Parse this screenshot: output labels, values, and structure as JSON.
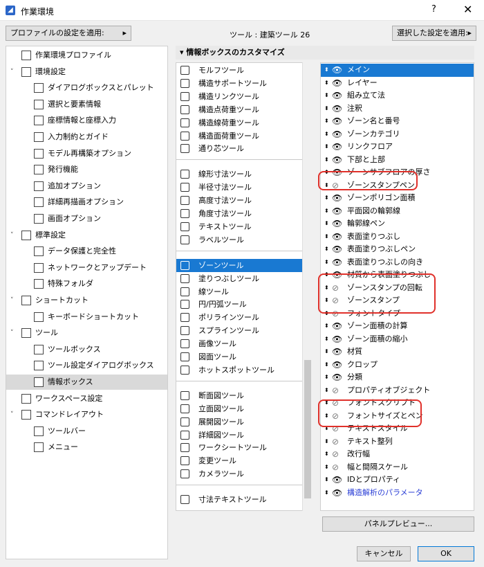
{
  "window": {
    "title": "作業環境",
    "help_label": "?",
    "close_label": "✕",
    "apply_profile_label": "プロファイルの設定を適用:",
    "tool_header": "ツール : 建築ツール 26",
    "apply_selected_label": "選択した設定を適用:"
  },
  "tree": [
    {
      "label": "作業環境プロファイル",
      "level": 0,
      "chev": ""
    },
    {
      "label": "環境設定",
      "level": 0,
      "chev": "˅"
    },
    {
      "label": "ダイアログボックスとパレット",
      "level": 1,
      "chev": ""
    },
    {
      "label": "選択と要素情報",
      "level": 1,
      "chev": ""
    },
    {
      "label": "座標情報と座標入力",
      "level": 1,
      "chev": ""
    },
    {
      "label": "入力制約とガイド",
      "level": 1,
      "chev": ""
    },
    {
      "label": "モデル再構築オプション",
      "level": 1,
      "chev": ""
    },
    {
      "label": "発行機能",
      "level": 1,
      "chev": ""
    },
    {
      "label": "追加オプション",
      "level": 1,
      "chev": ""
    },
    {
      "label": "詳細再描画オプション",
      "level": 1,
      "chev": ""
    },
    {
      "label": "画面オプション",
      "level": 1,
      "chev": ""
    },
    {
      "label": "標準設定",
      "level": 0,
      "chev": "˅"
    },
    {
      "label": "データ保護と完全性",
      "level": 1,
      "chev": ""
    },
    {
      "label": "ネットワークとアップデート",
      "level": 1,
      "chev": ""
    },
    {
      "label": "特殊フォルダ",
      "level": 1,
      "chev": ""
    },
    {
      "label": "ショートカット",
      "level": 0,
      "chev": "˅"
    },
    {
      "label": "キーボードショートカット",
      "level": 1,
      "chev": ""
    },
    {
      "label": "ツール",
      "level": 0,
      "chev": "˅"
    },
    {
      "label": "ツールボックス",
      "level": 1,
      "chev": ""
    },
    {
      "label": "ツール設定ダイアログボックス",
      "level": 1,
      "chev": ""
    },
    {
      "label": "情報ボックス",
      "level": 1,
      "chev": "",
      "selected": true
    },
    {
      "label": "ワークスペース設定",
      "level": 0,
      "chev": ""
    },
    {
      "label": "コマンドレイアウト",
      "level": 0,
      "chev": "˅"
    },
    {
      "label": "ツールバー",
      "level": 1,
      "chev": ""
    },
    {
      "label": "メニュー",
      "level": 1,
      "chev": ""
    }
  ],
  "section_title": "情報ボックスのカスタマイズ",
  "tool_list": [
    {
      "label": "モルフツール"
    },
    {
      "label": "構造サポートツール"
    },
    {
      "label": "構造リンクツール"
    },
    {
      "label": "構造点荷重ツール"
    },
    {
      "label": "構造線荷重ツール"
    },
    {
      "label": "構造面荷重ツール"
    },
    {
      "label": "通り芯ツール"
    },
    {
      "sep": true
    },
    {
      "label": "線形寸法ツール"
    },
    {
      "label": "半径寸法ツール"
    },
    {
      "label": "高度寸法ツール"
    },
    {
      "label": "角度寸法ツール"
    },
    {
      "label": "テキストツール"
    },
    {
      "label": "ラベルツール"
    },
    {
      "sep": true
    },
    {
      "label": "ゾーンツール",
      "selected": true
    },
    {
      "label": "塗りつぶしツール"
    },
    {
      "label": "線ツール"
    },
    {
      "label": "円/円弧ツール"
    },
    {
      "label": "ポリラインツール"
    },
    {
      "label": "スプラインツール"
    },
    {
      "label": "画像ツール"
    },
    {
      "label": "図面ツール"
    },
    {
      "label": "ホットスポットツール"
    },
    {
      "sep": true
    },
    {
      "label": "断面図ツール"
    },
    {
      "label": "立面図ツール"
    },
    {
      "label": "展開図ツール"
    },
    {
      "label": "詳細図ツール"
    },
    {
      "label": "ワークシートツール"
    },
    {
      "label": "変更ツール"
    },
    {
      "label": "カメラツール"
    },
    {
      "sep": true
    },
    {
      "label": "寸法テキストツール"
    }
  ],
  "panel_list": [
    {
      "label": "メイン",
      "visible": true,
      "selected": true
    },
    {
      "label": "レイヤー",
      "visible": true
    },
    {
      "label": "組み立て法",
      "visible": true
    },
    {
      "label": "注釈",
      "visible": true
    },
    {
      "label": "ゾーン名と番号",
      "visible": true
    },
    {
      "label": "ゾーンカテゴリ",
      "visible": true
    },
    {
      "label": "リンクフロア",
      "visible": true
    },
    {
      "label": "下部と上部",
      "visible": true
    },
    {
      "label": "ゾーンサブフロアの厚さ",
      "visible": true
    },
    {
      "label": "ゾーンスタンプペン",
      "visible": false
    },
    {
      "label": "ゾーンポリゴン面積",
      "visible": true
    },
    {
      "label": "平面図の輪郭線",
      "visible": true
    },
    {
      "label": "輪郭線ペン",
      "visible": true
    },
    {
      "label": "表面塗りつぶし",
      "visible": true
    },
    {
      "label": "表面塗りつぶしペン",
      "visible": true
    },
    {
      "label": "表面塗りつぶしの向き",
      "visible": true
    },
    {
      "label": "材質から表面塗りつぶし",
      "visible": true
    },
    {
      "label": "ゾーンスタンプの回転",
      "visible": false
    },
    {
      "label": "ゾーンスタンプ",
      "visible": false
    },
    {
      "label": "フォントタイプ",
      "visible": false
    },
    {
      "label": "ゾーン面積の計算",
      "visible": true
    },
    {
      "label": "ゾーン面積の縮小",
      "visible": true
    },
    {
      "label": "材質",
      "visible": true
    },
    {
      "label": "クロップ",
      "visible": true
    },
    {
      "label": "分類",
      "visible": true
    },
    {
      "label": "プロパティオブジェクト",
      "visible": false
    },
    {
      "label": "フォントスクリプト",
      "visible": false
    },
    {
      "label": "フォントサイズとペン",
      "visible": false
    },
    {
      "label": "テキストスタイル",
      "visible": false
    },
    {
      "label": "テキスト整列",
      "visible": false
    },
    {
      "label": "改行幅",
      "visible": false
    },
    {
      "label": "幅と間隔スケール",
      "visible": false
    },
    {
      "label": "IDとプロパティ",
      "visible": true
    },
    {
      "label": "構造解析のパラメータ",
      "visible": true,
      "link": true
    }
  ],
  "panel_preview_label": "パネルプレビュー...",
  "cancel_label": "キャンセル",
  "ok_label": "OK",
  "colors": {
    "selection": "#1979d2",
    "highlight_box": "#e0302a",
    "link": "#2b3fd6"
  }
}
